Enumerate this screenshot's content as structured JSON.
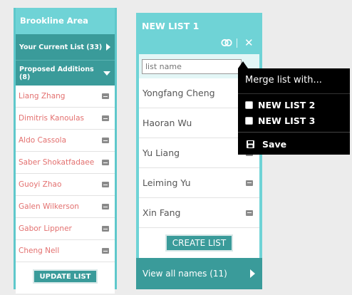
{
  "left_panel": {
    "title": "Brookline Area",
    "current_list_label": "Your Current List (33)",
    "proposed_label": "Proposed Additions (8)",
    "names": [
      "Liang Zhang",
      "Dimitris Kanoulas",
      "Aldo Cassola",
      "Saber Shokatfadaee",
      "Guoyi Zhao",
      "Galen Wilkerson",
      "Gabor Lippner",
      "Cheng Nell"
    ],
    "update_button": "UPDATE LIST"
  },
  "right_panel": {
    "title": "NEW LIST 1",
    "input_placeholder": "list name",
    "names": [
      "Yongfang Cheng",
      "Haoran Wu",
      "Yu Liang",
      "Leiming Yu",
      "Xin Fang"
    ],
    "create_button": "CREATE LIST",
    "view_all": "View all names (11)"
  },
  "dropdown": {
    "header": "Merge list with...",
    "options": [
      "NEW LIST 2",
      "NEW LIST 3"
    ],
    "save": "Save"
  },
  "colors": {
    "panel": "#6fd3d6",
    "dark_teal": "#3a9b9a",
    "name_red": "#e3706f"
  },
  "icons": {
    "link": "link-icon",
    "close": "close-icon",
    "remove": "minus-icon",
    "save": "floppy-icon"
  }
}
